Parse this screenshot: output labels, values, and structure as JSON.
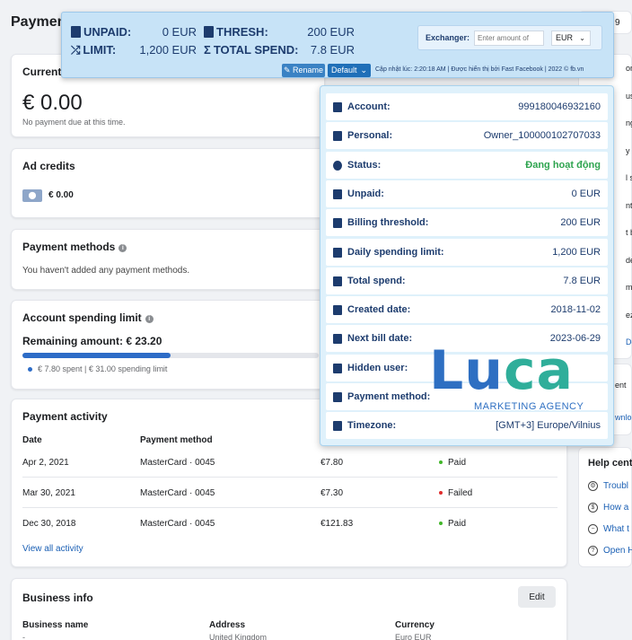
{
  "page": {
    "title": "Paymen"
  },
  "current": {
    "title": "Current",
    "amount": "€ 0.00",
    "note": "No payment due at this time."
  },
  "ad_credits": {
    "title": "Ad credits",
    "value": "€ 0.00"
  },
  "payment_methods": {
    "title": "Payment methods",
    "note": "You haven't added any payment methods."
  },
  "spending_limit": {
    "title": "Account spending limit",
    "remaining": "Remaining amount: € 23.20",
    "legend": "€ 7.80 spent | € 31.00 spending limit",
    "spent_fraction": 0.5
  },
  "activity": {
    "title": "Payment activity",
    "headers": {
      "date": "Date",
      "method": "Payment method"
    },
    "rows": [
      {
        "date": "Apr 2, 2021",
        "method": "MasterCard · 0045",
        "amount": "€7.80",
        "status": "Paid",
        "status_color": "#42b72a"
      },
      {
        "date": "Mar 30, 2021",
        "method": "MasterCard · 0045",
        "amount": "€7.30",
        "status": "Failed",
        "status_color": "#e02d2d"
      },
      {
        "date": "Dec 30, 2018",
        "method": "MasterCard · 0045",
        "amount": "€121.83",
        "status": "Paid",
        "status_color": "#42b72a"
      }
    ],
    "view_all": "View all activity"
  },
  "business": {
    "title": "Business info",
    "edit": "Edit",
    "name_label": "Business name",
    "name_value": "-",
    "address_label": "Address",
    "address_value": "United Kingdom",
    "currency_label": "Currency",
    "currency_value": "Euro EUR"
  },
  "right_col": {
    "top_field": "9",
    "fragments": [
      "ona",
      "us:",
      "ng th",
      "y spe",
      "l spe",
      "nted",
      "t bill",
      "den u",
      "ment",
      "ezon",
      "Down"
    ],
    "mid": [
      "ent",
      "wnlo"
    ],
    "help_title": "Help cent",
    "help_items": [
      {
        "icon": "settings-icon",
        "label": "Troubl"
      },
      {
        "icon": "dollar-icon",
        "label": "How a"
      },
      {
        "icon": "minus-circle-icon",
        "label": "What t"
      },
      {
        "icon": "question-icon",
        "label": "Open H"
      }
    ]
  },
  "ext_bar": {
    "unpaid_label": "UNPAID:",
    "unpaid_value": "0 EUR",
    "thresh_label": "THRESH:",
    "thresh_value": "200 EUR",
    "limit_label": "LIMIT:",
    "limit_value": "1,200 EUR",
    "total_label": "TOTAL SPEND:",
    "total_value": "7.8 EUR",
    "exchanger_label": "Exchanger:",
    "exchanger_placeholder": "Enter amount of",
    "currency_selected": "EUR",
    "rename": "Rename",
    "default": "Default",
    "update_note": "Cập nhật lúc: 2:20:18 AM | Được hiển thị bởi Fast Facebook | 2022 © fb.vn"
  },
  "details": [
    {
      "key": "Account:",
      "value": "999180046932160",
      "icon": "document-icon"
    },
    {
      "key": "Personal:",
      "value": "Owner_100000102707033",
      "icon": "briefcase-icon"
    },
    {
      "key": "Status:",
      "value": "Đang hoạt động",
      "icon": "check-circle-icon",
      "green": true
    },
    {
      "key": "Unpaid:",
      "value": "0 EUR",
      "icon": "document-icon"
    },
    {
      "key": "Billing threshold:",
      "value": "200 EUR",
      "icon": "money-icon"
    },
    {
      "key": "Daily spending limit:",
      "value": "1,200 EUR",
      "icon": "shuffle-icon"
    },
    {
      "key": "Total spend:",
      "value": "7.8 EUR",
      "icon": "sigma-icon"
    },
    {
      "key": "Created date:",
      "value": "2018-11-02",
      "icon": "calendar-icon"
    },
    {
      "key": "Next bill date:",
      "value": "2023-06-29",
      "icon": "calendar-plus-icon"
    },
    {
      "key": "Hidden user:",
      "value": "",
      "icon": "users-icon"
    },
    {
      "key": "Payment method:",
      "value": "",
      "icon": "card-icon"
    },
    {
      "key": "Timezone:",
      "value": "[GMT+3] Europe/Vilnius",
      "icon": "list-icon"
    }
  ],
  "logo": {
    "word_a": "Lu",
    "word_b": "ca",
    "tagline": "MARKETING AGENCY"
  },
  "colors": {
    "accent": "#2d6cc7",
    "ext_bg": "#c7e3f7",
    "popup_bg": "#dff1fb",
    "logo_blue": "#2e6fc2",
    "logo_teal": "#2fae9a"
  }
}
